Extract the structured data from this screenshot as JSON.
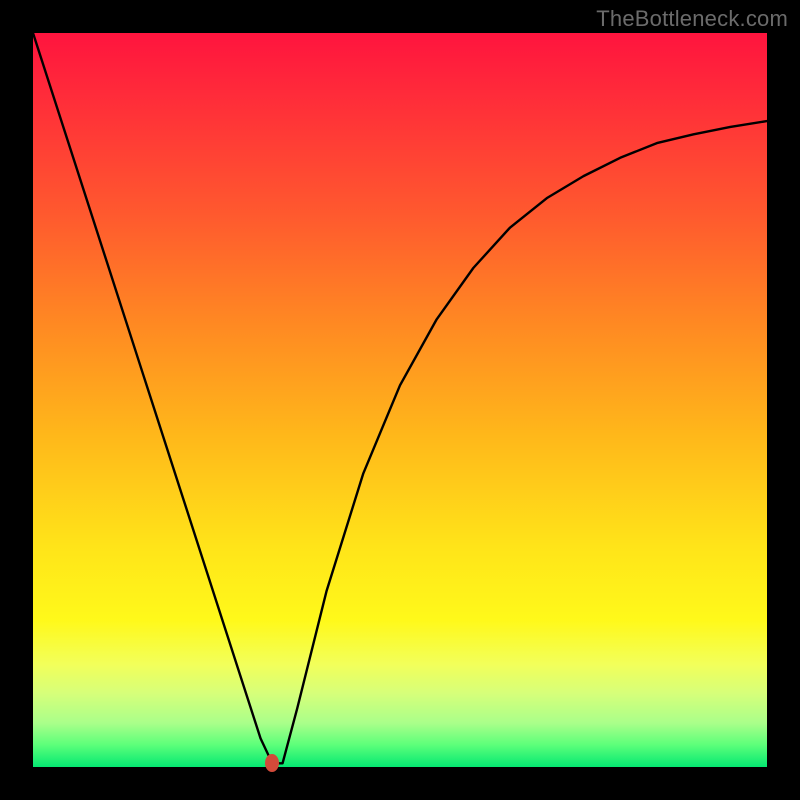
{
  "watermark": "TheBottleneck.com",
  "marker": {
    "x_frac": 0.326,
    "y_frac": 0.994,
    "color": "#d24a3a"
  },
  "chart_data": {
    "type": "line",
    "title": "",
    "xlabel": "",
    "ylabel": "",
    "xlim": [
      0,
      1
    ],
    "ylim": [
      0,
      1
    ],
    "series": [
      {
        "name": "curve",
        "x": [
          0.0,
          0.05,
          0.1,
          0.15,
          0.2,
          0.25,
          0.28,
          0.3,
          0.31,
          0.326,
          0.34,
          0.36,
          0.4,
          0.45,
          0.5,
          0.55,
          0.6,
          0.65,
          0.7,
          0.75,
          0.8,
          0.85,
          0.9,
          0.95,
          1.0
        ],
        "y": [
          1.0,
          0.845,
          0.69,
          0.535,
          0.38,
          0.225,
          0.132,
          0.07,
          0.039,
          0.005,
          0.005,
          0.08,
          0.24,
          0.4,
          0.52,
          0.61,
          0.68,
          0.735,
          0.775,
          0.805,
          0.83,
          0.85,
          0.862,
          0.872,
          0.88
        ]
      }
    ],
    "annotations": [
      {
        "text": "TheBottleneck.com",
        "pos": "top-right"
      }
    ]
  }
}
